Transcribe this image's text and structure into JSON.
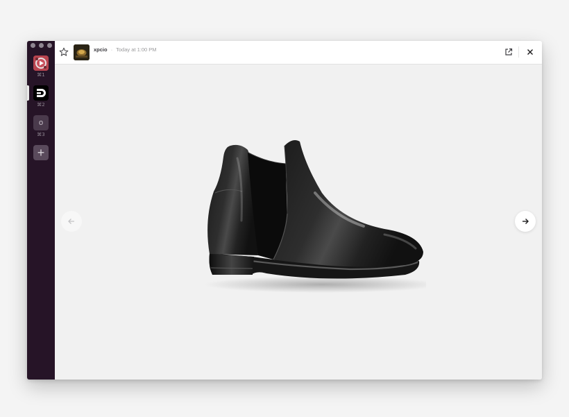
{
  "sidebar": {
    "workspaces": [
      {
        "shortcut": "⌘1",
        "icon": "workspace-avatar-red"
      },
      {
        "shortcut": "⌘2",
        "icon": "workspace-logo-black"
      },
      {
        "shortcut": "⌘3",
        "icon": "workspace-letter",
        "letter": "o"
      }
    ],
    "add_label": "+"
  },
  "header": {
    "user": "xpcio",
    "separator": "·",
    "timestamp": "Today at 1:00 PM",
    "icons": [
      "star-icon",
      "open-in-browser-icon",
      "close-icon"
    ]
  },
  "viewer": {
    "image_subject": "black-leather-chelsea-boot",
    "prev_icon": "arrow-left-icon",
    "next_icon": "arrow-right-icon"
  },
  "colors": {
    "sidebar_bg": "#261427",
    "viewer_bg": "#f1f1f1",
    "header_bg": "#ffffff"
  }
}
